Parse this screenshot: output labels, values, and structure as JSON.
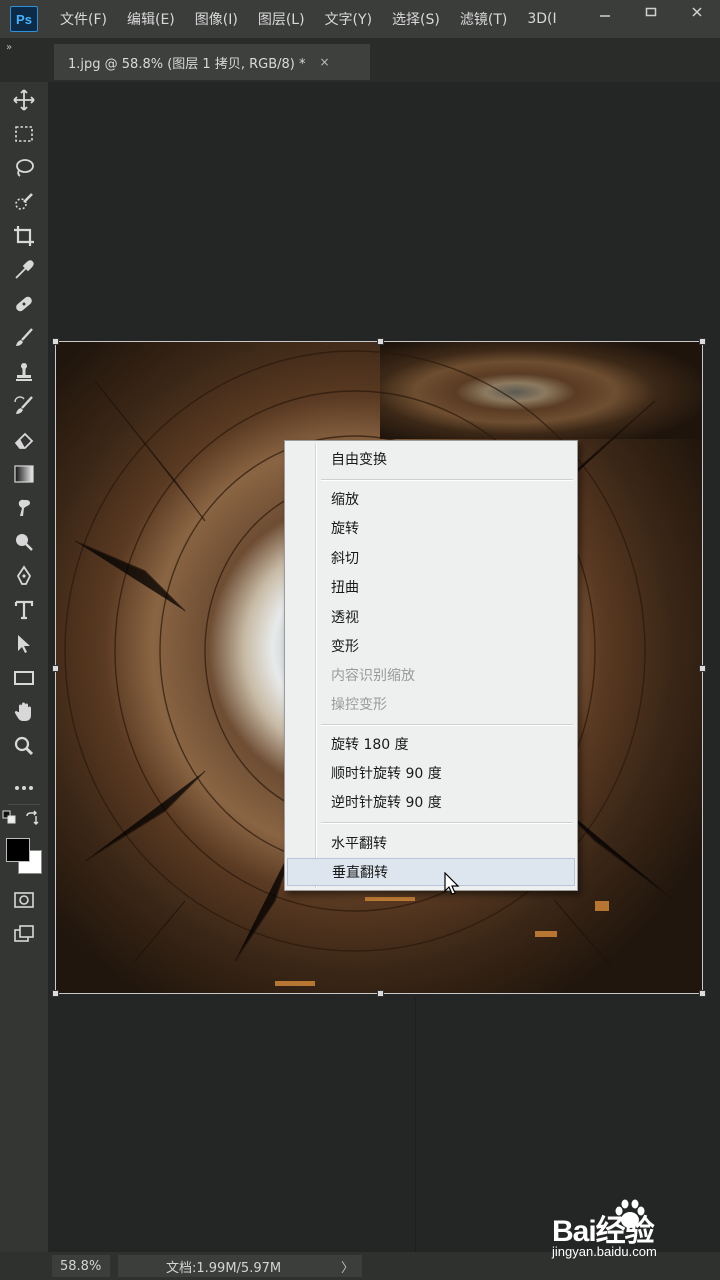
{
  "menubar": {
    "app_logo": "Ps",
    "items": [
      "文件(F)",
      "编辑(E)",
      "图像(I)",
      "图层(L)",
      "文字(Y)",
      "选择(S)",
      "滤镜(T)",
      "3D(I"
    ],
    "window_controls": [
      "minimize-icon",
      "restore-icon",
      "close-icon"
    ]
  },
  "document": {
    "tab_title": "1.jpg @ 58.8% (图层 1 拷贝, RGB/8) *",
    "tab_close": "×"
  },
  "toolbar": {
    "collapse_glyph": "»",
    "tools": [
      "move-tool",
      "marquee-tool",
      "lasso-tool",
      "quick-select-tool",
      "crop-tool",
      "eyedropper-tool",
      "healing-brush-tool",
      "brush-tool",
      "clone-stamp-tool",
      "history-brush-tool",
      "eraser-tool",
      "gradient-tool",
      "smudge-tool",
      "dodge-tool",
      "pen-tool",
      "type-tool",
      "path-select-tool",
      "rectangle-tool",
      "hand-tool",
      "zoom-tool",
      "more-tools"
    ],
    "foreground_color": "#000000",
    "background_color": "#ffffff"
  },
  "context_menu": {
    "items": [
      {
        "label": "自由变换",
        "enabled": true
      },
      {
        "label": "缩放",
        "enabled": true
      },
      {
        "label": "旋转",
        "enabled": true
      },
      {
        "label": "斜切",
        "enabled": true
      },
      {
        "label": "扭曲",
        "enabled": true
      },
      {
        "label": "透视",
        "enabled": true
      },
      {
        "label": "变形",
        "enabled": true
      },
      {
        "label": "内容识别缩放",
        "enabled": false
      },
      {
        "label": "操控变形",
        "enabled": false
      },
      {
        "label": "旋转 180 度",
        "enabled": true
      },
      {
        "label": "顺时针旋转 90 度",
        "enabled": true
      },
      {
        "label": "逆时针旋转 90 度",
        "enabled": true
      },
      {
        "label": "水平翻转",
        "enabled": true
      },
      {
        "label": "垂直翻转",
        "enabled": true,
        "hovered": true
      }
    ]
  },
  "statusbar": {
    "zoom": "58.8%",
    "doc_info": "文档:1.99M/5.97M",
    "arrow": "〉"
  },
  "watermark": {
    "brand": "Bai经验",
    "url": "jingyan.baidu.com"
  },
  "colors": {
    "menubar_bg": "#3b3d3b",
    "workspace_bg": "#232624",
    "menu_bg": "#eef0f0",
    "menu_hover": "#dde6ef",
    "ps_blue": "#44b4ff"
  }
}
